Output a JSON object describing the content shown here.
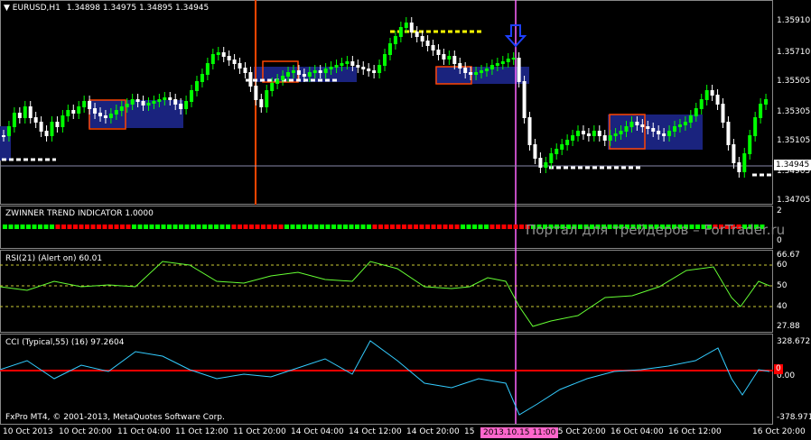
{
  "header": {
    "symbol": "EURUSD,H1",
    "ohlc": "1.34898 1.34975 1.34895 1.34945"
  },
  "indicators": {
    "trend": "ZWINNER TREND INDICATOR 1.0000",
    "rsi": "RSI(21) (Alert on) 60.01",
    "cci": "CCI (Typical,55) (16) 97.2604"
  },
  "price_axis": [
    "1.35910",
    "1.35710",
    "1.35505",
    "1.35305",
    "1.35105",
    "1.34705"
  ],
  "current_price": "1.34945",
  "current_price_behind": "1.34905",
  "trend_axis": [
    "2",
    "0"
  ],
  "rsi_axis": [
    "66.67",
    "60",
    "50",
    "40",
    "27.88"
  ],
  "cci_axis": [
    "328.672",
    "0.00",
    "-378.9717"
  ],
  "cci_tag": "0",
  "time_axis": [
    "10 Oct 2013",
    "10 Oct 20:00",
    "11 Oct 04:00",
    "11 Oct 12:00",
    "11 Oct 20:00",
    "14 Oct 04:00",
    "14 Oct 12:00",
    "14 Oct 20:00",
    "15 Oct 04:00",
    "15 Oct 20:00",
    "16 Oct 04:00",
    "16 Oct 12:00",
    "16 Oct 20:00"
  ],
  "time_axis_cut": "15",
  "cursor_time": "2013.10.15 11:00",
  "watermark": "Портал для трейдеров – ForTrader.ru",
  "copyright": "FxPro MT4, © 2001-2013, MetaQuotes Software Corp.",
  "colors": {
    "bull": "#00ff00",
    "bear": "#ffffff",
    "box_fill": "#1a237e",
    "box_border": "#ff4500",
    "vline_orange": "#ff4500",
    "vline_pink": "#ff66ff",
    "rsi_up": "#66ff33",
    "rsi_down": "#ff2020",
    "cci_line": "#33ccff",
    "cci_zero": "#ff0000"
  },
  "icons": {
    "dropdown": "triangle-down-icon",
    "arrow": "blue-down-arrow-icon"
  }
}
